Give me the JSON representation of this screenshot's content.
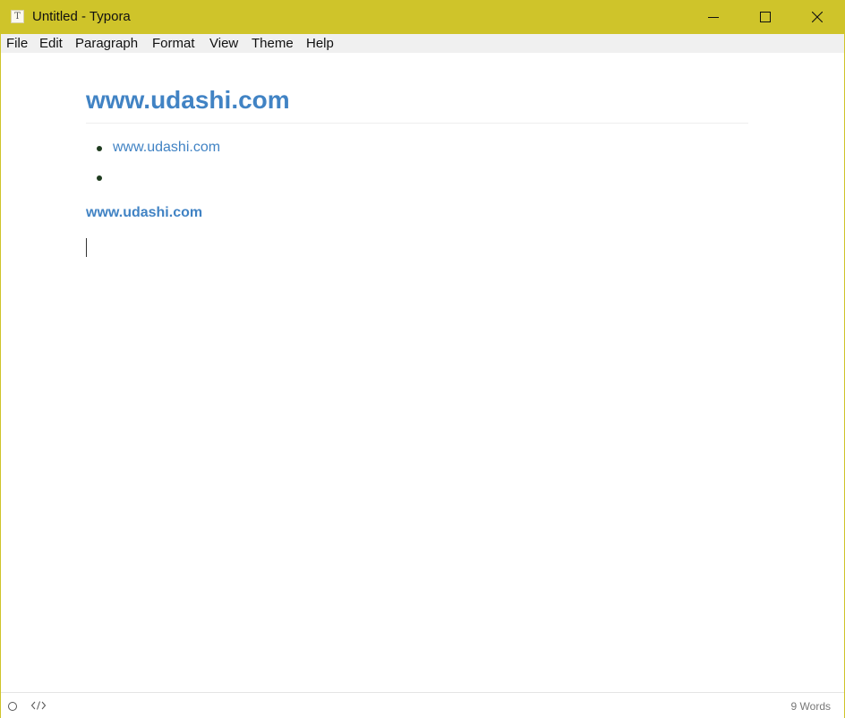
{
  "window": {
    "title": "Untitled - Typora",
    "app_icon_letter": "T",
    "accent_color": "#cfc42a",
    "controls": [
      "minimize-icon",
      "maximize-icon",
      "close-icon"
    ]
  },
  "menu": {
    "items": [
      {
        "label": "File"
      },
      {
        "label": "Edit"
      },
      {
        "label": "Paragraph"
      },
      {
        "label": "Format"
      },
      {
        "label": "View"
      },
      {
        "label": "Theme"
      },
      {
        "label": "Help"
      }
    ]
  },
  "document": {
    "heading": "www.udashi.com",
    "list_items": [
      "www.udashi.com",
      ""
    ],
    "bold_link": "www.udashi.com",
    "link_color": "#4183c4"
  },
  "status": {
    "word_count": "9 Words",
    "icons": [
      "outline-toggle-icon",
      "source-code-icon"
    ]
  }
}
